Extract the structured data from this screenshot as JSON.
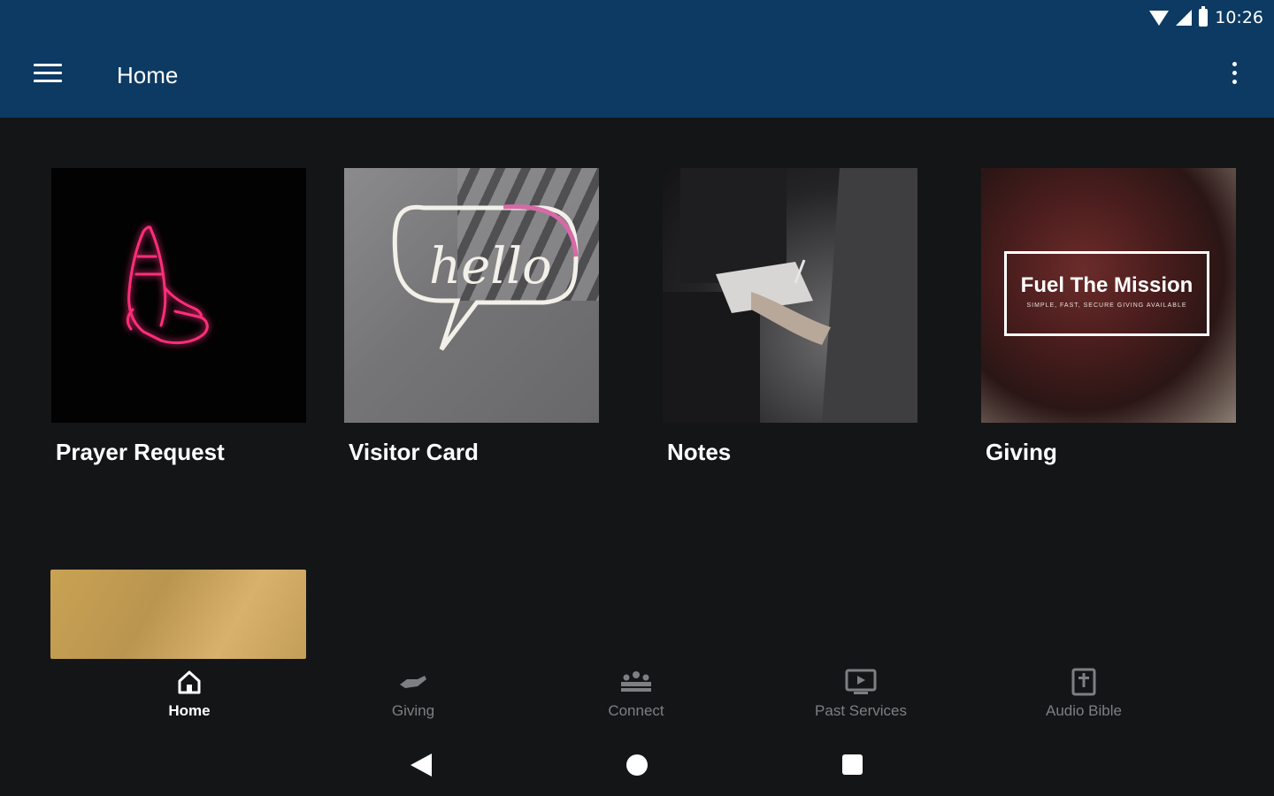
{
  "status_bar": {
    "time": "10:26"
  },
  "app_bar": {
    "title": "Home"
  },
  "cards": [
    {
      "label": "Prayer Request"
    },
    {
      "label": "Visitor Card",
      "image_text": "hello"
    },
    {
      "label": "Notes"
    },
    {
      "label": "Giving",
      "image_title": "Fuel The Mission",
      "image_subtitle": "SIMPLE, FAST, SECURE GIVING AVAILABLE"
    }
  ],
  "bottom_nav": {
    "items": [
      {
        "label": "Home",
        "icon": "home-icon",
        "active": true
      },
      {
        "label": "Giving",
        "icon": "hand-giving-icon",
        "active": false
      },
      {
        "label": "Connect",
        "icon": "group-icon",
        "active": false
      },
      {
        "label": "Past Services",
        "icon": "tv-play-icon",
        "active": false
      },
      {
        "label": "Audio Bible",
        "icon": "bible-icon",
        "active": false
      }
    ]
  },
  "colors": {
    "app_bar": "#0c3a63",
    "background": "#141517",
    "nav_inactive": "#7d7f82",
    "neon_pink": "#ff2d7a"
  }
}
